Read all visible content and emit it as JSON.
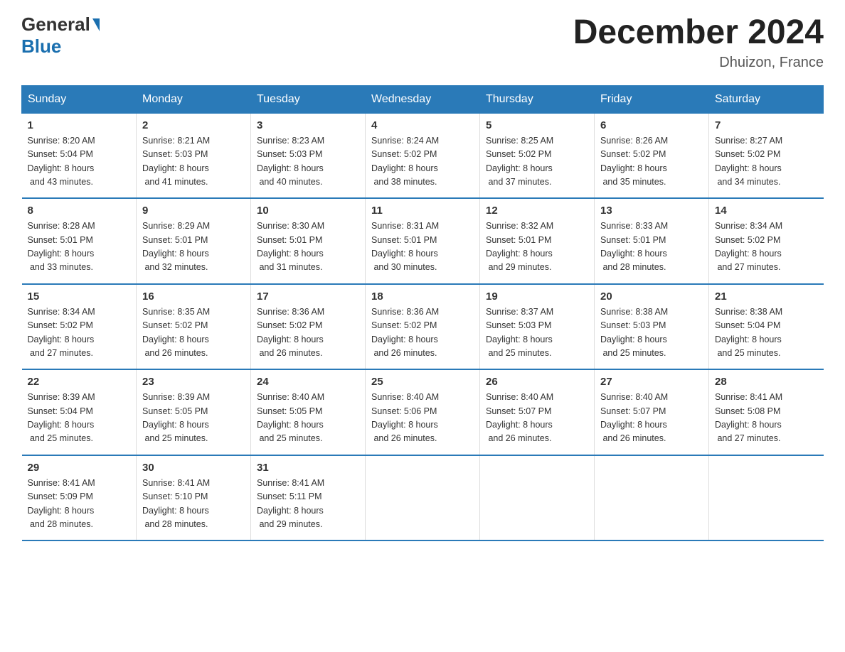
{
  "header": {
    "logo_line1": "General",
    "logo_line2": "Blue",
    "month_title": "December 2024",
    "location": "Dhuizon, France"
  },
  "days_of_week": [
    "Sunday",
    "Monday",
    "Tuesday",
    "Wednesday",
    "Thursday",
    "Friday",
    "Saturday"
  ],
  "weeks": [
    [
      {
        "num": "1",
        "sunrise": "8:20 AM",
        "sunset": "5:04 PM",
        "daylight": "8 hours and 43 minutes."
      },
      {
        "num": "2",
        "sunrise": "8:21 AM",
        "sunset": "5:03 PM",
        "daylight": "8 hours and 41 minutes."
      },
      {
        "num": "3",
        "sunrise": "8:23 AM",
        "sunset": "5:03 PM",
        "daylight": "8 hours and 40 minutes."
      },
      {
        "num": "4",
        "sunrise": "8:24 AM",
        "sunset": "5:02 PM",
        "daylight": "8 hours and 38 minutes."
      },
      {
        "num": "5",
        "sunrise": "8:25 AM",
        "sunset": "5:02 PM",
        "daylight": "8 hours and 37 minutes."
      },
      {
        "num": "6",
        "sunrise": "8:26 AM",
        "sunset": "5:02 PM",
        "daylight": "8 hours and 35 minutes."
      },
      {
        "num": "7",
        "sunrise": "8:27 AM",
        "sunset": "5:02 PM",
        "daylight": "8 hours and 34 minutes."
      }
    ],
    [
      {
        "num": "8",
        "sunrise": "8:28 AM",
        "sunset": "5:01 PM",
        "daylight": "8 hours and 33 minutes."
      },
      {
        "num": "9",
        "sunrise": "8:29 AM",
        "sunset": "5:01 PM",
        "daylight": "8 hours and 32 minutes."
      },
      {
        "num": "10",
        "sunrise": "8:30 AM",
        "sunset": "5:01 PM",
        "daylight": "8 hours and 31 minutes."
      },
      {
        "num": "11",
        "sunrise": "8:31 AM",
        "sunset": "5:01 PM",
        "daylight": "8 hours and 30 minutes."
      },
      {
        "num": "12",
        "sunrise": "8:32 AM",
        "sunset": "5:01 PM",
        "daylight": "8 hours and 29 minutes."
      },
      {
        "num": "13",
        "sunrise": "8:33 AM",
        "sunset": "5:01 PM",
        "daylight": "8 hours and 28 minutes."
      },
      {
        "num": "14",
        "sunrise": "8:34 AM",
        "sunset": "5:02 PM",
        "daylight": "8 hours and 27 minutes."
      }
    ],
    [
      {
        "num": "15",
        "sunrise": "8:34 AM",
        "sunset": "5:02 PM",
        "daylight": "8 hours and 27 minutes."
      },
      {
        "num": "16",
        "sunrise": "8:35 AM",
        "sunset": "5:02 PM",
        "daylight": "8 hours and 26 minutes."
      },
      {
        "num": "17",
        "sunrise": "8:36 AM",
        "sunset": "5:02 PM",
        "daylight": "8 hours and 26 minutes."
      },
      {
        "num": "18",
        "sunrise": "8:36 AM",
        "sunset": "5:02 PM",
        "daylight": "8 hours and 26 minutes."
      },
      {
        "num": "19",
        "sunrise": "8:37 AM",
        "sunset": "5:03 PM",
        "daylight": "8 hours and 25 minutes."
      },
      {
        "num": "20",
        "sunrise": "8:38 AM",
        "sunset": "5:03 PM",
        "daylight": "8 hours and 25 minutes."
      },
      {
        "num": "21",
        "sunrise": "8:38 AM",
        "sunset": "5:04 PM",
        "daylight": "8 hours and 25 minutes."
      }
    ],
    [
      {
        "num": "22",
        "sunrise": "8:39 AM",
        "sunset": "5:04 PM",
        "daylight": "8 hours and 25 minutes."
      },
      {
        "num": "23",
        "sunrise": "8:39 AM",
        "sunset": "5:05 PM",
        "daylight": "8 hours and 25 minutes."
      },
      {
        "num": "24",
        "sunrise": "8:40 AM",
        "sunset": "5:05 PM",
        "daylight": "8 hours and 25 minutes."
      },
      {
        "num": "25",
        "sunrise": "8:40 AM",
        "sunset": "5:06 PM",
        "daylight": "8 hours and 26 minutes."
      },
      {
        "num": "26",
        "sunrise": "8:40 AM",
        "sunset": "5:07 PM",
        "daylight": "8 hours and 26 minutes."
      },
      {
        "num": "27",
        "sunrise": "8:40 AM",
        "sunset": "5:07 PM",
        "daylight": "8 hours and 26 minutes."
      },
      {
        "num": "28",
        "sunrise": "8:41 AM",
        "sunset": "5:08 PM",
        "daylight": "8 hours and 27 minutes."
      }
    ],
    [
      {
        "num": "29",
        "sunrise": "8:41 AM",
        "sunset": "5:09 PM",
        "daylight": "8 hours and 28 minutes."
      },
      {
        "num": "30",
        "sunrise": "8:41 AM",
        "sunset": "5:10 PM",
        "daylight": "8 hours and 28 minutes."
      },
      {
        "num": "31",
        "sunrise": "8:41 AM",
        "sunset": "5:11 PM",
        "daylight": "8 hours and 29 minutes."
      },
      null,
      null,
      null,
      null
    ]
  ],
  "labels": {
    "sunrise_prefix": "Sunrise: ",
    "sunset_prefix": "Sunset: ",
    "daylight_prefix": "Daylight: "
  }
}
